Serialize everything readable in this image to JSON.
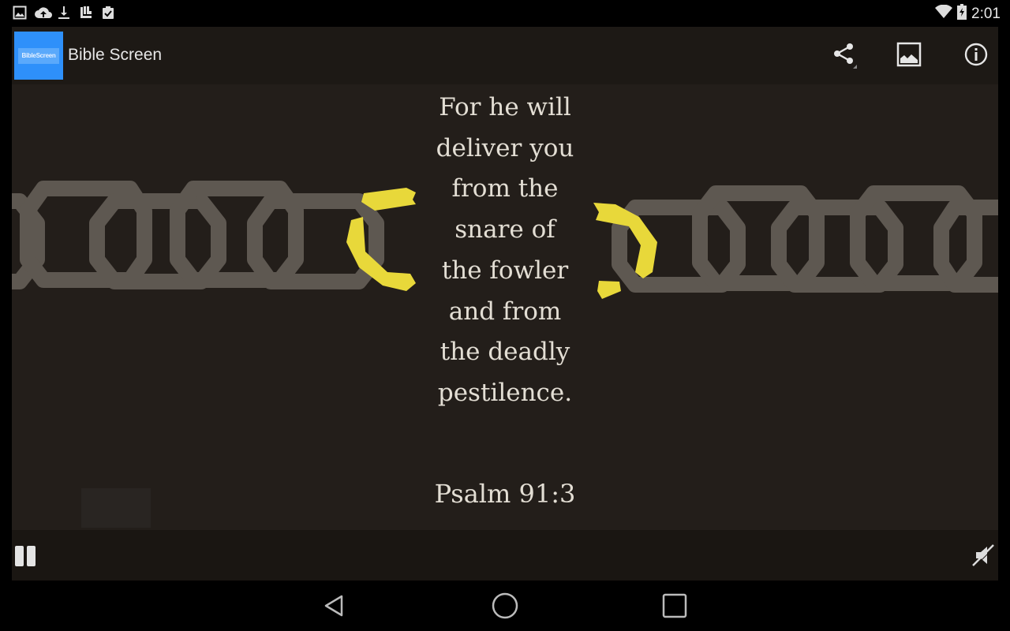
{
  "status_bar": {
    "notification_icons": [
      "image-icon",
      "cloud-upload-icon",
      "download-icon",
      "library-icon",
      "clipboard-check-icon"
    ],
    "system_icons": [
      "wifi-icon",
      "battery-charging-icon"
    ],
    "time": "2:01"
  },
  "action_bar": {
    "logo_text": "BibleScreen",
    "title": "Bible Screen",
    "actions": [
      {
        "name": "share",
        "icon": "share-icon"
      },
      {
        "name": "wallpaper",
        "icon": "image-icon"
      },
      {
        "name": "info",
        "icon": "info-icon"
      }
    ]
  },
  "content": {
    "verse_lines": [
      "For he will",
      "deliver you",
      "from the",
      "snare of",
      "the fowler",
      "and from",
      "the deadly",
      "pestilence."
    ],
    "reference": "Psalm 91:3",
    "colors": {
      "background": "#231e1a",
      "chain": "#5e5851",
      "broken_link": "#e8d83a",
      "text": "#e3ded4"
    }
  },
  "controls": {
    "playback_state": "playing",
    "pause_icon": "pause-icon",
    "sound_state": "muted",
    "mute_icon": "volume-off-icon"
  },
  "nav_bar": {
    "buttons": [
      "back",
      "home",
      "recents"
    ]
  }
}
